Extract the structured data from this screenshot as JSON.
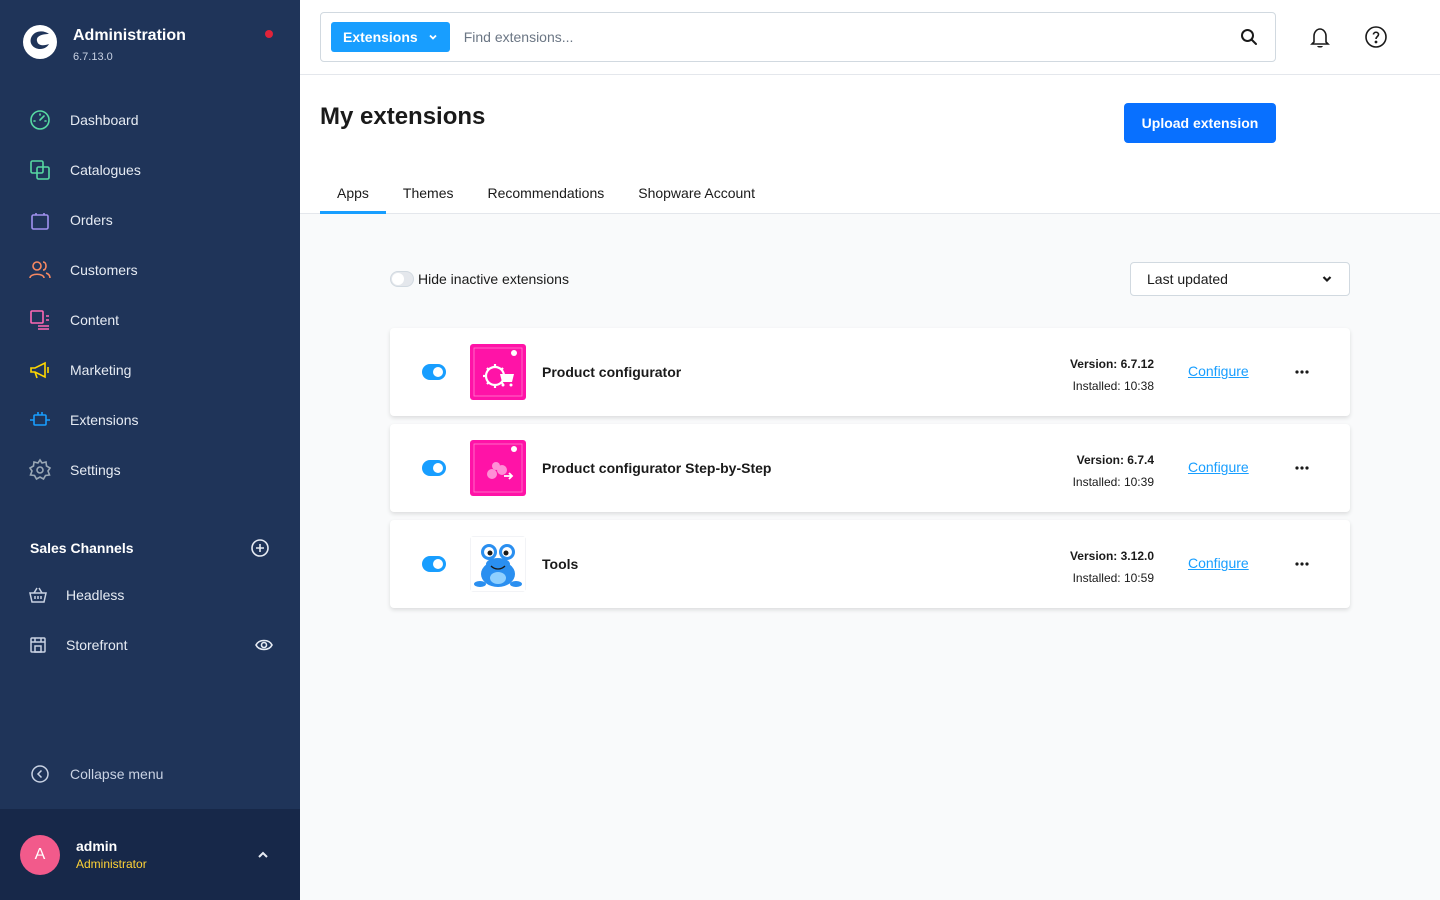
{
  "app": {
    "title": "Administration",
    "version": "6.7.13.0"
  },
  "sidebar": {
    "items": [
      {
        "label": "Dashboard",
        "icon": "dashboard-icon",
        "color": "#57d9a3"
      },
      {
        "label": "Catalogues",
        "icon": "catalogues-icon",
        "color": "#57d9a3"
      },
      {
        "label": "Orders",
        "icon": "orders-icon",
        "color": "#a092f0"
      },
      {
        "label": "Customers",
        "icon": "customers-icon",
        "color": "#f88962"
      },
      {
        "label": "Content",
        "icon": "content-icon",
        "color": "#ff68b4"
      },
      {
        "label": "Marketing",
        "icon": "marketing-icon",
        "color": "#ffd700"
      },
      {
        "label": "Extensions",
        "icon": "extensions-icon",
        "color": "#189eff"
      },
      {
        "label": "Settings",
        "icon": "settings-icon",
        "color": "#9aa8b5"
      }
    ],
    "sales_channels": {
      "title": "Sales Channels",
      "items": [
        {
          "label": "Headless"
        },
        {
          "label": "Storefront"
        }
      ]
    },
    "collapse_label": "Collapse menu"
  },
  "user": {
    "initial": "A",
    "name": "admin",
    "role": "Administrator"
  },
  "search": {
    "type_label": "Extensions",
    "placeholder": "Find extensions..."
  },
  "page": {
    "title": "My extensions",
    "upload_label": "Upload extension",
    "tabs": [
      {
        "label": "Apps",
        "active": true
      },
      {
        "label": "Themes"
      },
      {
        "label": "Recommendations"
      },
      {
        "label": "Shopware Account"
      }
    ]
  },
  "filter": {
    "hide_inactive_label": "Hide inactive extensions",
    "sort_label": "Last updated"
  },
  "extensions": [
    {
      "name": "Product configurator",
      "version": "Version: 6.7.12",
      "installed": "Installed: 10:38",
      "configure": "Configure",
      "active": true,
      "logo": "configurator-logo"
    },
    {
      "name": "Product configurator Step-by-Step",
      "version": "Version: 6.7.4",
      "installed": "Installed: 10:39",
      "configure": "Configure",
      "active": true,
      "logo": "step-by-step-logo"
    },
    {
      "name": "Tools",
      "version": "Version: 3.12.0",
      "installed": "Installed: 10:59",
      "configure": "Configure",
      "active": true,
      "logo": "frog-logo"
    }
  ],
  "colors": {
    "sidebar_bg": "#1f3459",
    "primary": "#0870ff",
    "accent": "#189eff",
    "brand_pink": "#ff13a7"
  }
}
